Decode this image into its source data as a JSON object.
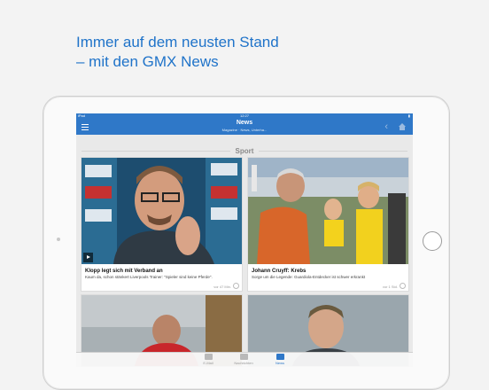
{
  "headline": {
    "line1": "Immer auf dem neusten Stand",
    "line2": "– mit den GMX News"
  },
  "status_bar": {
    "carrier": "iPad",
    "time": "12:27",
    "battery": "▮"
  },
  "nav": {
    "title": "News",
    "subtitle": "Magazine · News, Unterha..."
  },
  "section": {
    "label": "Sport"
  },
  "cards": [
    {
      "title": "Klopp legt sich mit Verband an",
      "desc": "Kaum da, schon stänkert Liverpools Trainer: \"Spieler sind keine Pferde\".",
      "time": "vor 47 Min."
    },
    {
      "title": "Johann Cruyff: Krebs",
      "desc": "Sorge um die Legende: Guardiola-Entdecker ist schwer erkrankt",
      "time": "vor 1 Std."
    }
  ],
  "tabs": [
    {
      "label": "E-Mail",
      "icon": "mail-icon"
    },
    {
      "label": "Nachrichten",
      "icon": "messages-icon"
    },
    {
      "label": "News",
      "icon": "news-icon"
    }
  ],
  "colors": {
    "accent": "#2f78c8",
    "headline": "#1f73c9"
  }
}
